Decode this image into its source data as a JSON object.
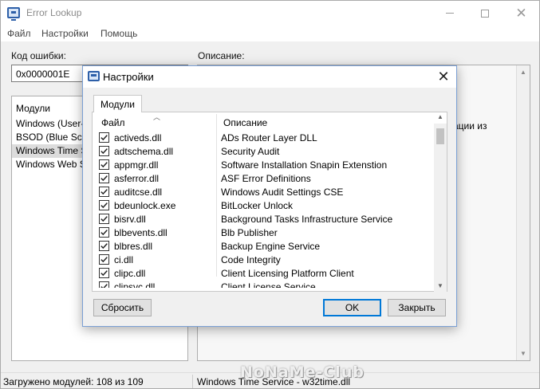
{
  "window": {
    "title": "Error Lookup"
  },
  "menu": [
    "Файл",
    "Настройки",
    "Помощь"
  ],
  "error_code": {
    "label": "Код ошибки:",
    "value": "0x0000001E"
  },
  "description": {
    "label": "Описание:",
    "visible_fragment": "ации из"
  },
  "modules_panel": {
    "header": "Модули",
    "items": [
      {
        "label": "Windows (User-M",
        "selected": false
      },
      {
        "label": "BSOD (Blue Scree",
        "selected": false
      },
      {
        "label": "Windows Time Se",
        "selected": true
      },
      {
        "label": "Windows Web Se",
        "selected": false
      }
    ]
  },
  "status": {
    "loaded": "Загружено модулей: 108 из 109",
    "current": "Windows Time Service - w32time.dll"
  },
  "watermark": "NoNaMe-Club",
  "dialog": {
    "title": "Настройки",
    "tab": "Модули",
    "columns": {
      "file": "Файл",
      "description": "Описание"
    },
    "rows": [
      {
        "file": "activeds.dll",
        "description": "ADs Router Layer DLL",
        "checked": true
      },
      {
        "file": "adtschema.dll",
        "description": "Security Audit",
        "checked": true
      },
      {
        "file": "appmgr.dll",
        "description": "Software Installation Snapin Extenstion",
        "checked": true
      },
      {
        "file": "asferror.dll",
        "description": "ASF Error Definitions",
        "checked": true
      },
      {
        "file": "auditcse.dll",
        "description": "Windows Audit Settings CSE",
        "checked": true
      },
      {
        "file": "bdeunlock.exe",
        "description": "BitLocker Unlock",
        "checked": true
      },
      {
        "file": "bisrv.dll",
        "description": "Background Tasks Infrastructure Service",
        "checked": true
      },
      {
        "file": "blbevents.dll",
        "description": "Blb Publisher",
        "checked": true
      },
      {
        "file": "blbres.dll",
        "description": "Backup Engine Service",
        "checked": true
      },
      {
        "file": "ci.dll",
        "description": "Code Integrity",
        "checked": true
      },
      {
        "file": "clipc.dll",
        "description": "Client Licensing Platform Client",
        "checked": true
      },
      {
        "file": "clipsvc.dll",
        "description": "Client License Service",
        "checked": true
      }
    ],
    "buttons": {
      "reset": "Сбросить",
      "ok": "OK",
      "close": "Закрыть"
    }
  },
  "colors": {
    "accent": "#0078d7",
    "selection": "#dcdcdc",
    "window_bg": "#f0f0f0"
  }
}
